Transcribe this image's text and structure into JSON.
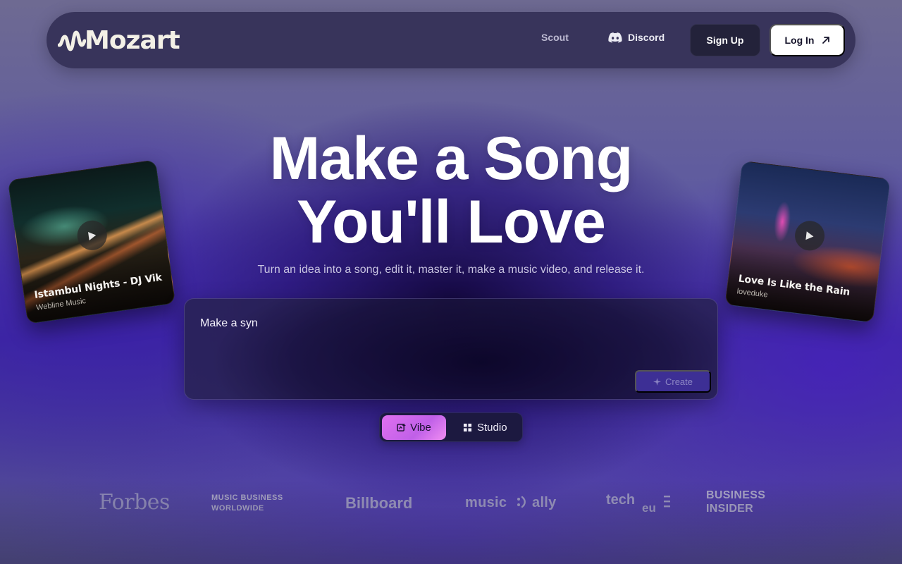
{
  "nav": {
    "logo_text": "Mozart",
    "links": {
      "scout": "Scout",
      "discord": "Discord"
    },
    "signup_label": "Sign Up",
    "login_label": "Log In"
  },
  "hero": {
    "title_line1": "Make a Song",
    "title_line2": "You'll Love",
    "subtitle": "Turn an idea into a song, edit it, master it, make a music video, and release it."
  },
  "prompt": {
    "value": "Make a syn",
    "create_label": "Create"
  },
  "modes": {
    "vibe_label": "Vibe",
    "studio_label": "Studio",
    "selected": "Vibe"
  },
  "cards": [
    {
      "title": "Istambul Nights - DJ Vik",
      "artist": "Webline Music"
    },
    {
      "title": "Love Is Like the Rain",
      "artist": "loveduke"
    }
  ],
  "press": {
    "forbes": "Forbes",
    "mbw_line1": "MUSIC BUSINESS",
    "mbw_line2": "WORLDWIDE",
    "billboard": "Billboard",
    "musically_1": "music",
    "musically_2": "ally",
    "techeu_1": "tech",
    "techeu_2": "eu",
    "bi_line1": "BUSINESS",
    "bi_line2": "INSIDER"
  },
  "icons": {
    "logo": "wave-logo-icon",
    "discord": "discord-icon",
    "login": "arrow-up-right-icon",
    "create": "sparkle-icon",
    "vibe": "vibe-icon",
    "studio": "grid-icon",
    "play": "play-icon"
  },
  "colors": {
    "accent_vibe": "#d86cf0",
    "create_button": "#3d2f95",
    "login_button": "#ffffff",
    "signup_button": "#23223a"
  }
}
